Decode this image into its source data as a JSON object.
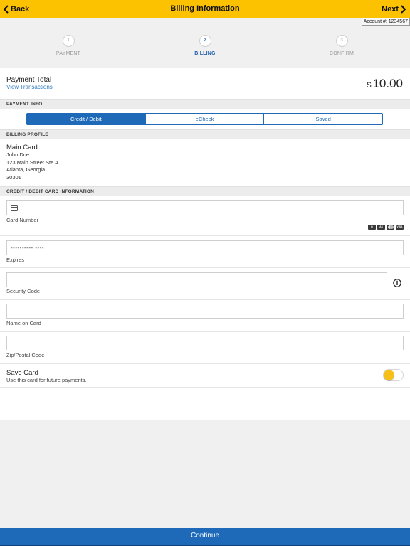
{
  "header": {
    "back_label": "Back",
    "title": "Billing Information",
    "next_label": "Next",
    "color": "#fcc200"
  },
  "account": {
    "label": "Account #: 1234567"
  },
  "steps": [
    {
      "number": "1",
      "label": "PAYMENT",
      "active": false
    },
    {
      "number": "2",
      "label": "BILLING",
      "active": true
    },
    {
      "number": "3",
      "label": "CONFIRM",
      "active": false
    }
  ],
  "payment_total": {
    "label": "Payment Total",
    "link": "View Transactions",
    "currency": "$",
    "amount": "10.00"
  },
  "payment_info": {
    "header": "PAYMENT INFO",
    "tabs": [
      "Credit / Debit",
      "eCheck",
      "Saved"
    ],
    "selected": "Credit / Debit",
    "accent": "#1e6ab8"
  },
  "billing_profile": {
    "header": "BILLING PROFILE",
    "title": "Main Card",
    "name": "John Doe",
    "street": "123 Main Street Ste A",
    "city_state": "Atlanta, Georgia",
    "zip": "30301"
  },
  "card_info": {
    "header": "CREDIT / DEBIT CARD INFORMATION",
    "card_number_label": "Card Number",
    "card_brands": [
      "discover-icon",
      "amex-icon",
      "mastercard-icon",
      "visa-icon"
    ],
    "expires_value": "---------- ----",
    "expires_label": "Expires",
    "security_code_label": "Security Code",
    "name_label": "Name on Card",
    "zip_label": "Zip/Postal Code"
  },
  "save_card": {
    "title": "Save Card",
    "subtitle": "Use this card for future payments.",
    "toggle_on": false
  },
  "footer": {
    "continue_label": "Continue",
    "color": "#1e6ab8"
  }
}
